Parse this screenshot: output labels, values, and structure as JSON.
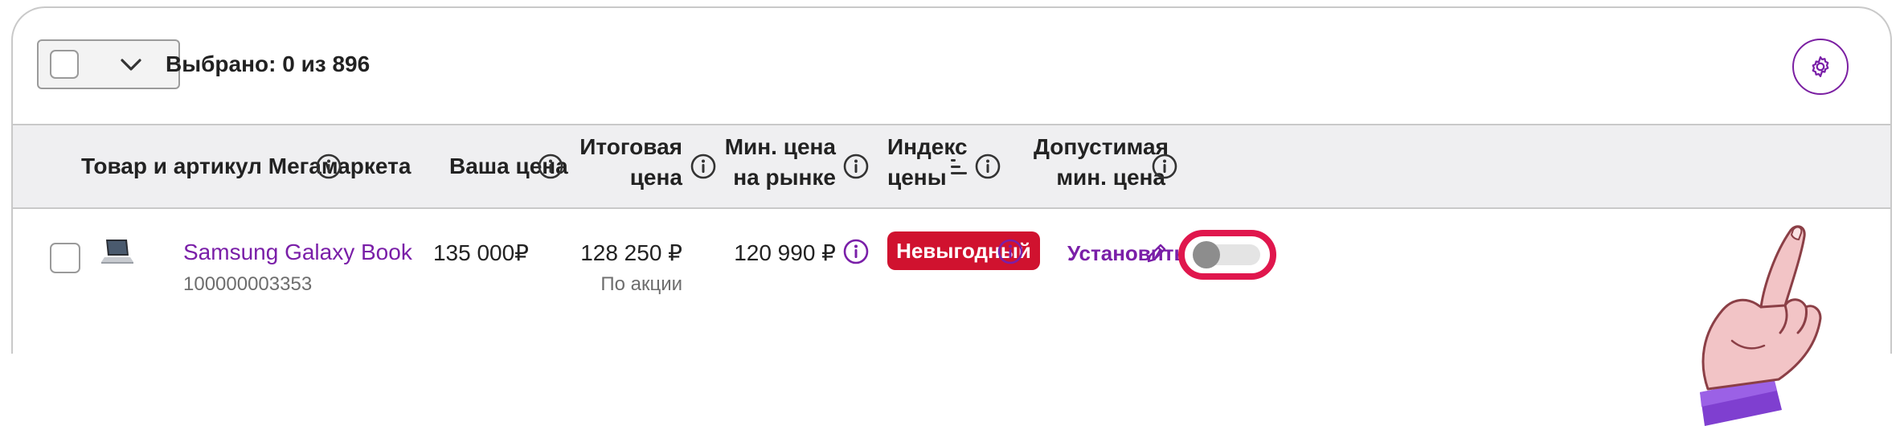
{
  "toolbar": {
    "selected_text": "Выбрано: 0 из 896"
  },
  "table": {
    "columns": [
      {
        "label": "Товар и артикул Мегамаркета"
      },
      {
        "label": "Ваша цена"
      },
      {
        "label_line1": "Итоговая",
        "label_line2": "цена"
      },
      {
        "label_line1": "Мин. цена",
        "label_line2": "на рынке"
      },
      {
        "label_line1": "Индекс",
        "label_line2": "цены"
      },
      {
        "label_line1": "Допустимая",
        "label_line2": "мин. цена"
      }
    ],
    "rows": [
      {
        "name": "Samsung Galaxy Book",
        "sku": "100000003353",
        "your_price": "135 000₽",
        "final_price": "128 250 ₽",
        "final_price_note": "По акции",
        "market_min_price": "120 990 ₽",
        "price_index": "Невыгодный",
        "allowed_min_action": "Установить",
        "toggle_on": false
      }
    ]
  },
  "colors": {
    "accent": "#7a1fa8",
    "badge_bad": "#d0122f",
    "highlight": "#e0174d",
    "header_bg": "#efeff1"
  }
}
